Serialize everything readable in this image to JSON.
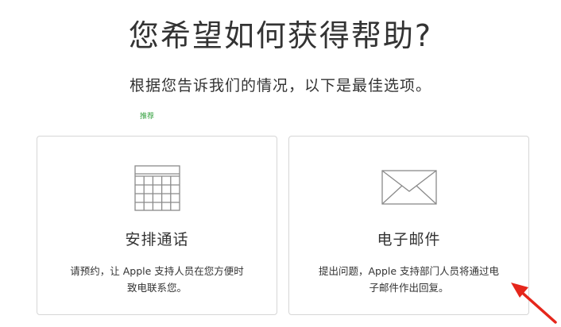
{
  "header": {
    "title": "您希望如何获得帮助?",
    "subtitle": "根据您告诉我们的情况，以下是最佳选项。",
    "recommend_label": "推荐"
  },
  "options": [
    {
      "icon": "calendar-icon",
      "title": "安排通话",
      "line1": "请预约，让 Apple 支持人员在您方便时",
      "line2": "致电联系您。"
    },
    {
      "icon": "envelope-icon",
      "title": "电子邮件",
      "line1": "提出问题，Apple 支持部门人员将通过电",
      "line2": "子邮件作出回复。"
    }
  ],
  "colors": {
    "recommend": "#2f9e3a",
    "annotation_arrow": "#e5261b",
    "card_border": "#d6d6d6",
    "icon_stroke": "#8a8a8a"
  }
}
